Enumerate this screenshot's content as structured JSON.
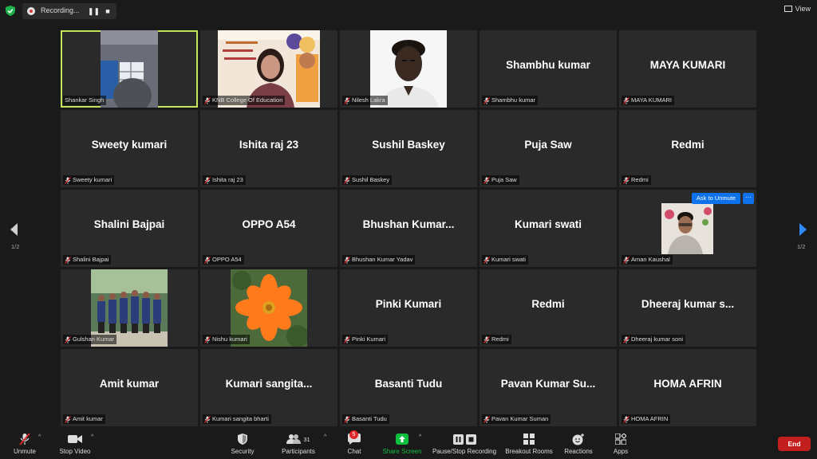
{
  "recording": {
    "label": "Recording...",
    "pause_icon": "pause-icon",
    "stop_icon": "stop-icon"
  },
  "view_label": "View",
  "pagination": {
    "left": "1/2",
    "right": "1/2"
  },
  "participants": [
    {
      "id": "p1",
      "display": "",
      "label": "Shankar Singh",
      "video": true,
      "active": true,
      "muted": false
    },
    {
      "id": "p2",
      "display": "",
      "label": "KNB College Of Education",
      "video": true,
      "muted": true
    },
    {
      "id": "p3",
      "display": "",
      "label": "Nilesh Lakra",
      "video": true,
      "muted": true
    },
    {
      "id": "p4",
      "display": "Shambhu kumar",
      "label": "Shambhu kumar",
      "muted": true
    },
    {
      "id": "p5",
      "display": "MAYA KUMARI",
      "label": "MAYA KUMARI",
      "muted": true
    },
    {
      "id": "p6",
      "display": "Sweety kumari",
      "label": "Sweety kumari",
      "muted": true
    },
    {
      "id": "p7",
      "display": "Ishita raj 23",
      "label": "Ishita raj 23",
      "muted": true
    },
    {
      "id": "p8",
      "display": "Sushil Baskey",
      "label": "Sushil Baskey",
      "muted": true
    },
    {
      "id": "p9",
      "display": "Puja Saw",
      "label": "Puja Saw",
      "muted": true
    },
    {
      "id": "p10",
      "display": "Redmi",
      "label": "Redmi",
      "muted": true
    },
    {
      "id": "p11",
      "display": "Shalini Bajpai",
      "label": "Shalini Bajpai",
      "muted": true
    },
    {
      "id": "p12",
      "display": "OPPO A54",
      "label": "OPPO A54",
      "muted": true
    },
    {
      "id": "p13",
      "display": "Bhushan  Kumar...",
      "label": "Bhushan Kumar Yadav",
      "muted": true
    },
    {
      "id": "p14",
      "display": "Kumari swati",
      "label": "Kumari swati",
      "muted": true
    },
    {
      "id": "p15",
      "display": "",
      "label": "Aman Kaushal",
      "video": true,
      "muted": true,
      "hover": true
    },
    {
      "id": "p16",
      "display": "",
      "label": "Gulshan Kumar",
      "video": true,
      "muted": true
    },
    {
      "id": "p17",
      "display": "",
      "label": "Nishu kumari",
      "video": true,
      "muted": true
    },
    {
      "id": "p18",
      "display": "Pinki Kumari",
      "label": "Pinki Kumari",
      "muted": true
    },
    {
      "id": "p19",
      "display": "Redmi",
      "label": "Redmi",
      "muted": true
    },
    {
      "id": "p20",
      "display": "Dheeraj  kumar s...",
      "label": "Dheeraj kumar soni",
      "muted": true
    },
    {
      "id": "p21",
      "display": "Amit kumar",
      "label": "Amit kumar",
      "muted": true
    },
    {
      "id": "p22",
      "display": "Kumari  sangita...",
      "label": "Kumari sangita bharti",
      "muted": true
    },
    {
      "id": "p23",
      "display": "Basanti Tudu",
      "label": "Basanti Tudu",
      "muted": true
    },
    {
      "id": "p24",
      "display": "Pavan  Kumar  Su...",
      "label": "Pavan Kumar Suman",
      "muted": true
    },
    {
      "id": "p25",
      "display": "HOMA AFRIN",
      "label": "HOMA AFRIN",
      "muted": true
    }
  ],
  "hover_actions": {
    "ask_to_unmute": "Ask to Unmute",
    "more": "···"
  },
  "toolbar": {
    "unmute": "Unmute",
    "stop_video": "Stop Video",
    "security": "Security",
    "participants": "Participants",
    "participants_count": "31",
    "chat": "Chat",
    "chat_badge": "5",
    "share_screen": "Share Screen",
    "pause_stop_recording": "Pause/Stop Recording",
    "breakout_rooms": "Breakout Rooms",
    "reactions": "Reactions",
    "apps": "Apps",
    "end": "End"
  },
  "colors": {
    "accent_green": "#c5e35b",
    "share_green": "#0fbf3e",
    "blue": "#0e72ed",
    "end_red": "#c41f1f"
  }
}
